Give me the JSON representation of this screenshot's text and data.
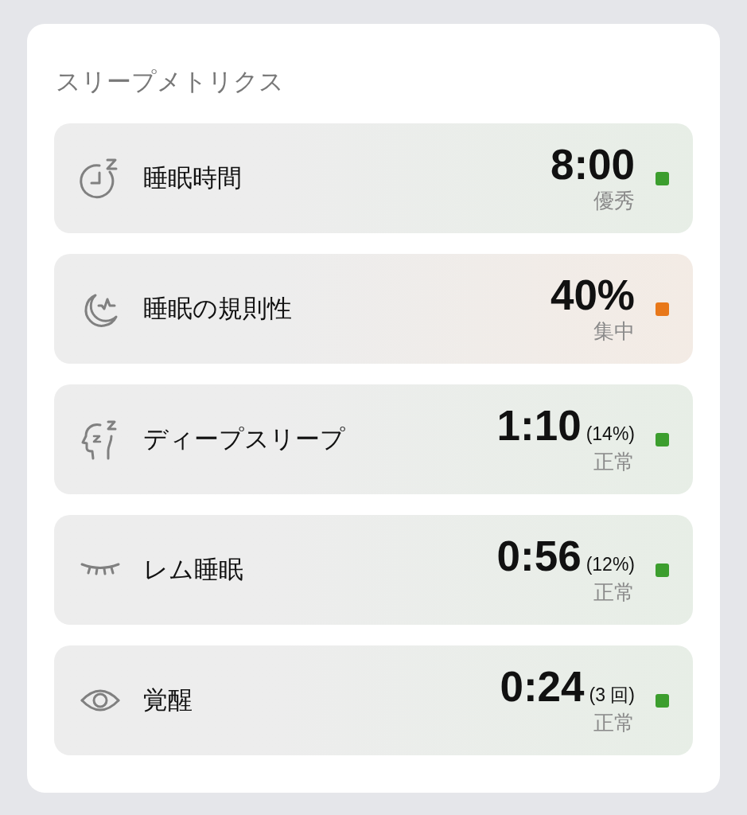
{
  "title": "スリープメトリクス",
  "metrics": [
    {
      "label": "睡眠時間",
      "value": "8:00",
      "status": "優秀",
      "color": "#3c9e2e"
    },
    {
      "label": "睡眠の規則性",
      "value": "40%",
      "status": "集中",
      "color": "#e8781a"
    },
    {
      "label": "ディープスリープ",
      "value": "1:10",
      "detail": "(14%)",
      "status": "正常",
      "color": "#3c9e2e"
    },
    {
      "label": "レム睡眠",
      "value": "0:56",
      "detail": "(12%)",
      "status": "正常",
      "color": "#3c9e2e"
    },
    {
      "label": "覚醒",
      "value": "0:24",
      "detail": "(3 回)",
      "status": "正常",
      "color": "#3c9e2e"
    }
  ]
}
